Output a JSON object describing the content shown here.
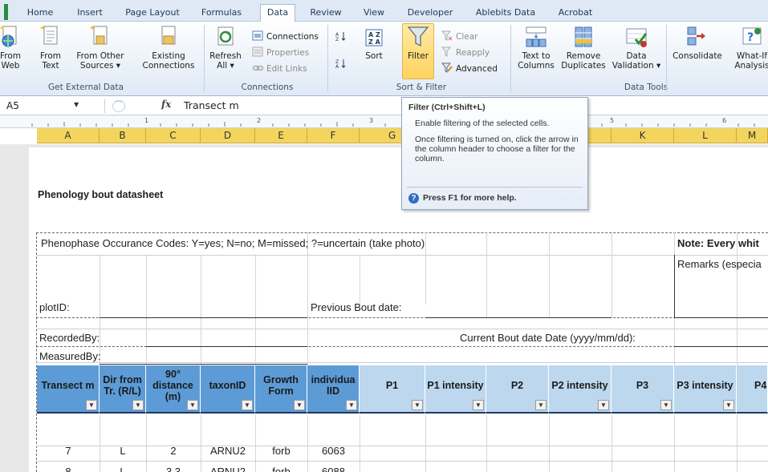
{
  "tabs": [
    "Home",
    "Insert",
    "Page Layout",
    "Formulas",
    "Data",
    "Review",
    "View",
    "Developer",
    "Ablebits Data",
    "Acrobat"
  ],
  "ribbon": {
    "get_external": {
      "from_web": [
        "From",
        "Web"
      ],
      "from_text": [
        "From",
        "Text"
      ],
      "from_other": [
        "From Other",
        "Sources ▾"
      ],
      "existing": [
        "Existing",
        "Connections"
      ],
      "group_label": "Get External Data"
    },
    "connections": {
      "refresh": [
        "Refresh",
        "All ▾"
      ],
      "connections": "Connections",
      "properties": "Properties",
      "edit_links": "Edit Links",
      "group_label": "Connections"
    },
    "sort_filter": {
      "sort": "Sort",
      "filter": "Filter",
      "clear": "Clear",
      "reapply": "Reapply",
      "advanced": "Advanced",
      "group_label": "Sort & Filter"
    },
    "data_tools": {
      "text_to_columns": [
        "Text to",
        "Columns"
      ],
      "remove_duplicates": [
        "Remove",
        "Duplicates"
      ],
      "data_validation": [
        "Data",
        "Validation ▾"
      ],
      "consolidate": "Consolidate",
      "what_if": [
        "What-If",
        "Analysis"
      ],
      "group_label": "Data Tools"
    }
  },
  "formula_bar": {
    "name_box": "A5",
    "fx": "fx",
    "value": "Transect m"
  },
  "column_headers": [
    "A",
    "B",
    "C",
    "D",
    "E",
    "F",
    "G",
    "K",
    "L",
    "M"
  ],
  "ruler_marks": [
    "1",
    "2",
    "3",
    "5",
    "6"
  ],
  "tooltip": {
    "title": "Filter (Ctrl+Shift+L)",
    "line1": "Enable filtering of the selected cells.",
    "line2": "Once filtering is turned on, click the arrow in the column header to choose a filter for the column.",
    "help": "Press F1 for more help."
  },
  "sheet": {
    "title": "Phenology bout datasheet",
    "codes": "Phenophase Occurance Codes: Y=yes; N=no; M=missed; ?=uncertain (take photo)",
    "note": "Note: Every whit",
    "remarks": "Remarks (especia",
    "plot_id": "plotID:",
    "previous_bout": "Previous Bout date:",
    "recorded_by": "RecordedBy:",
    "current_bout": "Current Bout date Date (yyyy/mm/dd):",
    "measured_by": "MeasuredBy:"
  },
  "table": {
    "headers": [
      "Transect m",
      "Dir from Tr. (R/L)",
      "90° distance (m)",
      "taxonID",
      "Growth Form",
      "individualID",
      "P1",
      "P1 intensity",
      "P2",
      "P2 intensity",
      "P3",
      "P3 intensity",
      "P4"
    ],
    "rows": [
      [
        "7",
        "L",
        "2",
        "ARNU2",
        "forb",
        "6063"
      ],
      [
        "8",
        "L",
        "3.3",
        "ARNU2",
        "forb",
        "6088"
      ]
    ]
  }
}
